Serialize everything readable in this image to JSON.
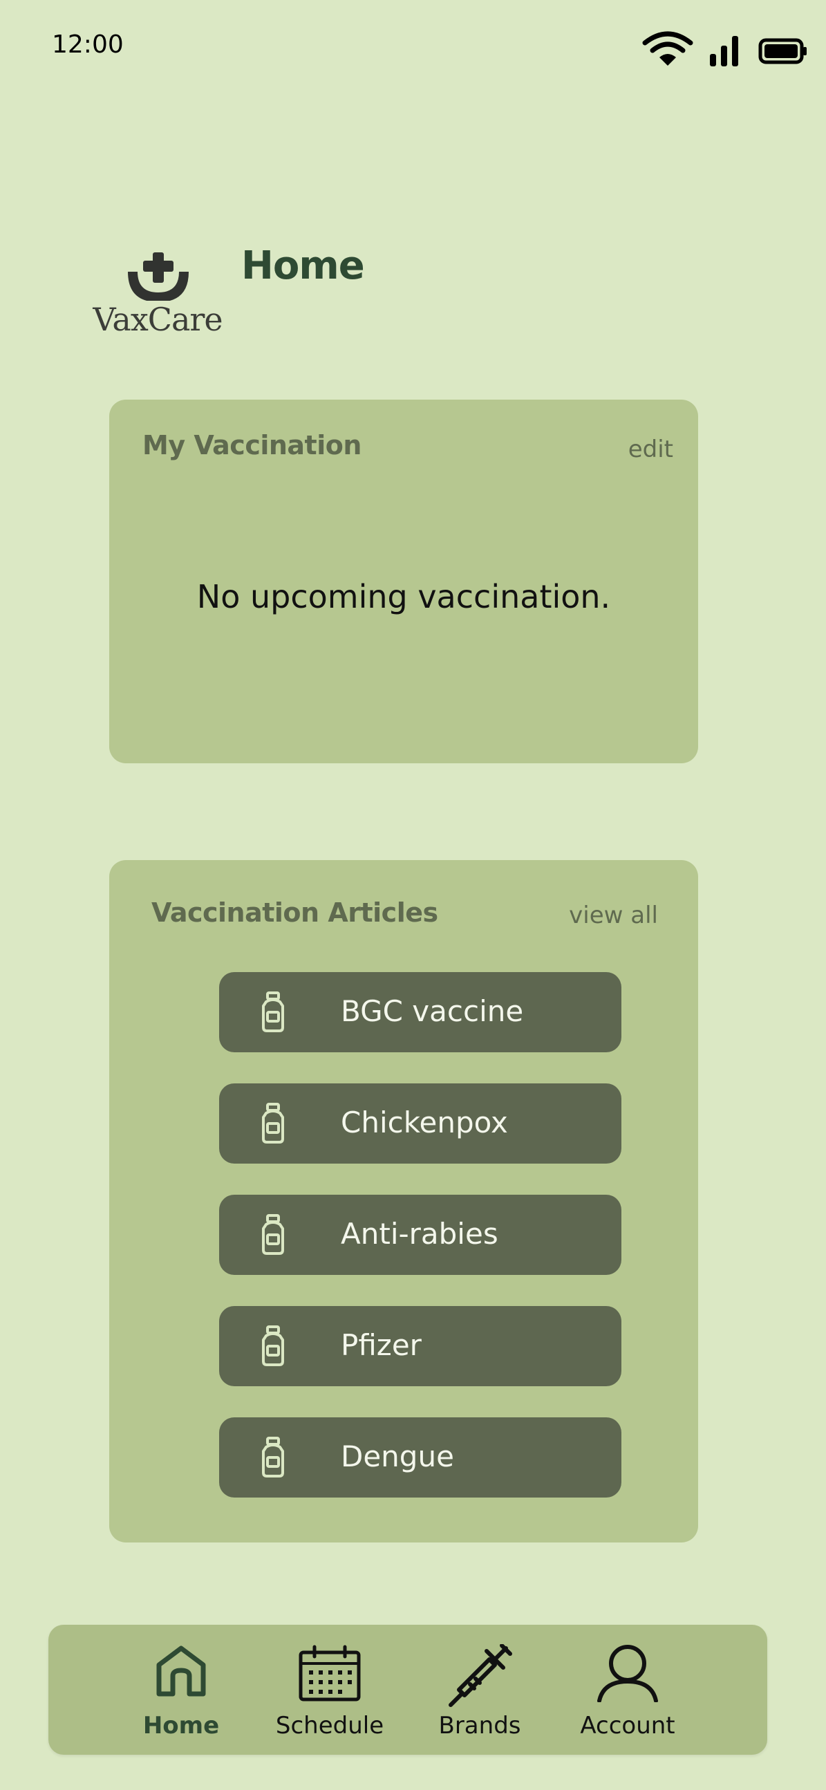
{
  "status_bar": {
    "time": "12:00"
  },
  "header": {
    "logo_text": "VaxCare",
    "title": "Home"
  },
  "my_vaccination": {
    "title": "My Vaccination",
    "edit_label": "edit",
    "empty_message": "No upcoming vaccination."
  },
  "articles": {
    "title": "Vaccination Articles",
    "view_all_label": "view all",
    "items": [
      {
        "label": "BGC vaccine",
        "icon": "vaccine-bottle-icon"
      },
      {
        "label": "Chickenpox",
        "icon": "vaccine-bottle-icon"
      },
      {
        "label": "Anti-rabies",
        "icon": "vaccine-bottle-icon"
      },
      {
        "label": "Pfizer",
        "icon": "vaccine-bottle-icon"
      },
      {
        "label": "Dengue",
        "icon": "vaccine-bottle-icon"
      }
    ]
  },
  "bottom_nav": {
    "items": [
      {
        "label": "Home",
        "icon": "home-icon",
        "active": true
      },
      {
        "label": "Schedule",
        "icon": "calendar-icon",
        "active": false
      },
      {
        "label": "Brands",
        "icon": "syringe-icon",
        "active": false
      },
      {
        "label": "Account",
        "icon": "user-icon",
        "active": false
      }
    ]
  },
  "colors": {
    "background": "#dbe8c4",
    "card": "#b6c790",
    "article_item": "#5e6750",
    "nav_bar": "#adbe87",
    "title_dark": "#2e4a33"
  }
}
